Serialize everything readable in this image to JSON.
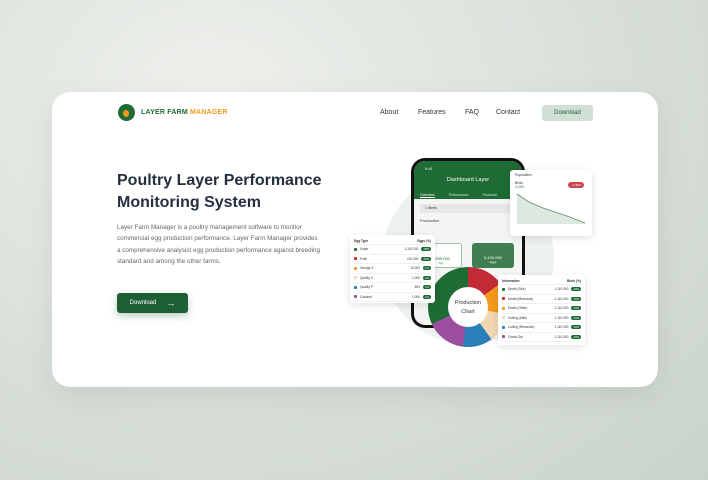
{
  "brand": {
    "part1": "LAYER FARM ",
    "part2": "MANAGER"
  },
  "nav": [
    "About",
    "Features",
    "FAQ",
    "Contact"
  ],
  "nav_download": "Download",
  "hero": {
    "title": "Poultry Layer Performance Monitoring System",
    "description": "Layer Farm Manager is a poultry management software to monitor commercial egg production performance. Layer Farm Manager provides a comprehensive analysist egg production performance against breeding standard and among the other farms.",
    "button": "Download"
  },
  "phone": {
    "time": "9:41",
    "title": "Dashboard Layer",
    "tabs": [
      "Overview",
      "Performance",
      "Financial"
    ],
    "period": "1 Week",
    "section": "Production",
    "stats": [
      {
        "value": "4,299.000",
        "unit": "Kg"
      },
      {
        "value": "6,100.000",
        "unit": "Eggs"
      }
    ]
  },
  "population": {
    "title": "Population",
    "label": "Birds",
    "value": "2,293",
    "badge": "-1.40%"
  },
  "egg_table": {
    "headers": [
      "Egg Type",
      "Eggs (%)"
    ],
    "rows": [
      {
        "name": "Super",
        "value": "1,110,000",
        "pct": "78%",
        "color": "#1e6b35"
      },
      {
        "name": "Putih",
        "value": "210,000",
        "pct": "15%",
        "color": "#c22a36"
      },
      {
        "name": "Omega 3",
        "value": "10,000",
        "pct": "1%",
        "color": "#f39a1d"
      },
      {
        "name": "Quality II",
        "value": "1,000",
        "pct": "1%",
        "color": "#f2d7b2"
      },
      {
        "name": "Quality P",
        "value": "500",
        "pct": "1%",
        "color": "#2a7fb8"
      },
      {
        "name": "Cracked",
        "value": "1,000",
        "pct": "1%",
        "color": "#9b4f9e"
      }
    ]
  },
  "info_table": {
    "headers": [
      "Information",
      "Birds (%)"
    ],
    "rows": [
      {
        "name": "Death (Sick)",
        "value": "1,110,000",
        "pct": "10%",
        "color": "#1e6b35"
      },
      {
        "name": "Death (Mechanic)",
        "value": "1,110,000",
        "pct": "10%",
        "color": "#c22a36"
      },
      {
        "name": "Death (Other)",
        "value": "1,110,000",
        "pct": "10%",
        "color": "#f39a1d"
      },
      {
        "name": "Culling (Afkir)",
        "value": "1,110,000",
        "pct": "10%",
        "color": "#f2d7b2"
      },
      {
        "name": "Culling (Removed)",
        "value": "1,110,000",
        "pct": "10%",
        "color": "#2a7fb8"
      },
      {
        "name": "Check Out",
        "value": "1,110,000",
        "pct": "10%",
        "color": "#9b4f9e"
      }
    ]
  },
  "donut": {
    "line1": "Production",
    "line2": "Chart"
  }
}
